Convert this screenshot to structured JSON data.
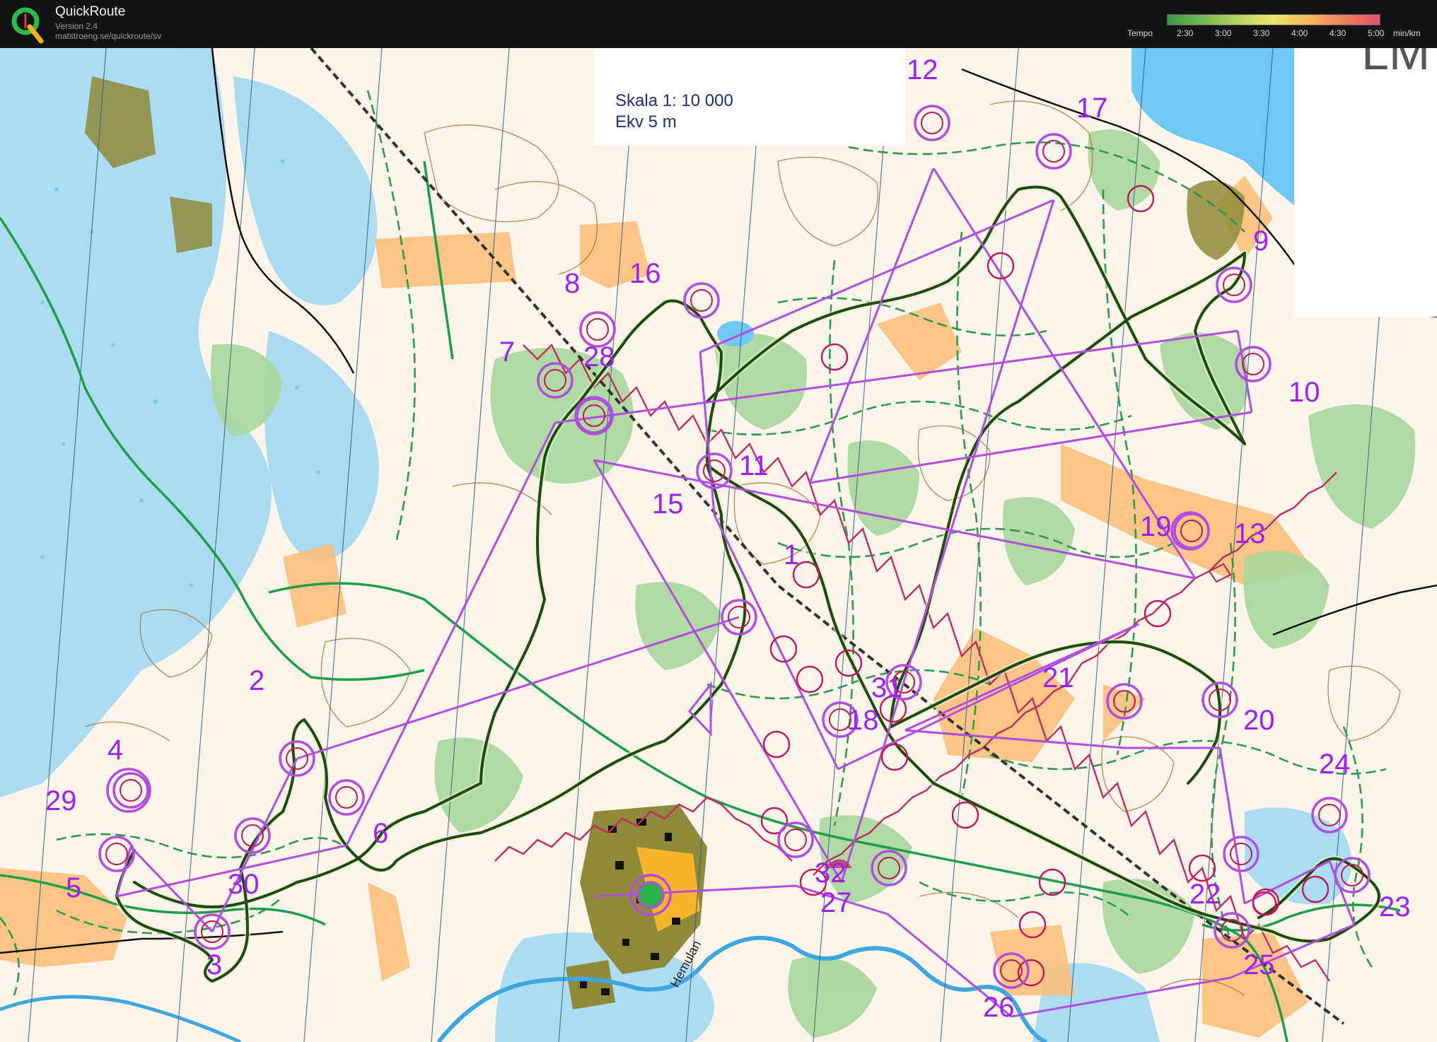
{
  "app": {
    "name": "QuickRoute",
    "version": "Version 2.4",
    "url": "matstroeng.se/quickroute/sv"
  },
  "tempo": {
    "label": "Tempo",
    "ticks": [
      "2:30",
      "3:00",
      "3:30",
      "4:00",
      "4:30",
      "5:00"
    ],
    "unit": "min/km",
    "colors": [
      "#3d9b46",
      "#79b956",
      "#bcd36b",
      "#e9e568",
      "#f2b55a",
      "#ec7a5c",
      "#e0556b"
    ]
  },
  "map": {
    "scale_text": "Skala 1: 10 000",
    "contour_text": "Ekv 5 m",
    "river_label": "Hemulan",
    "corner_text": "LM",
    "colors": {
      "course": "#b24de0",
      "control_ring": "#c2185b",
      "route": "#1f4a16",
      "forest_green": "#a9d69c",
      "open_yellow": "#f9c07c",
      "marsh_blue": "#9dd7f2",
      "water": "#6fc8f2",
      "contour": "#b06a2c",
      "path": "#2e9a4e"
    },
    "controls": [
      {
        "label": "1"
      },
      {
        "label": "2"
      },
      {
        "label": "3"
      },
      {
        "label": "4"
      },
      {
        "label": "5"
      },
      {
        "label": "6"
      },
      {
        "label": "7"
      },
      {
        "label": "8"
      },
      {
        "label": "9"
      },
      {
        "label": "10"
      },
      {
        "label": "11"
      },
      {
        "label": "12"
      },
      {
        "label": "13"
      },
      {
        "label": "15"
      },
      {
        "label": "16"
      },
      {
        "label": "17"
      },
      {
        "label": "18"
      },
      {
        "label": "19"
      },
      {
        "label": "20"
      },
      {
        "label": "21"
      },
      {
        "label": "22"
      },
      {
        "label": "23"
      },
      {
        "label": "24"
      },
      {
        "label": "25"
      },
      {
        "label": "26"
      },
      {
        "label": "27"
      },
      {
        "label": "28"
      },
      {
        "label": "29"
      },
      {
        "label": "30"
      },
      {
        "label": "31"
      },
      {
        "label": "32"
      }
    ]
  }
}
